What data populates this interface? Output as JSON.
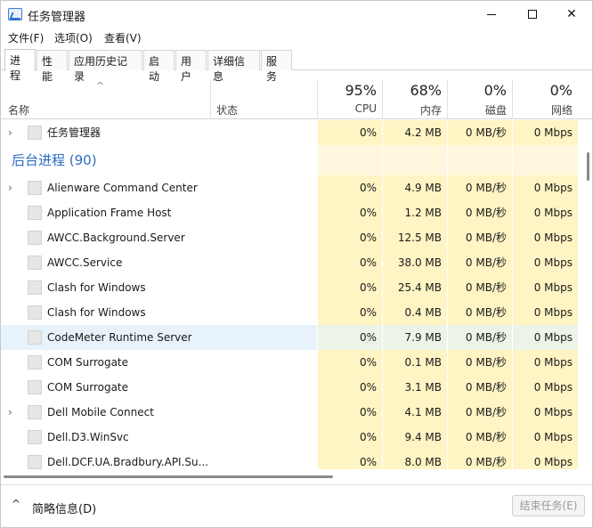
{
  "window": {
    "title": "任务管理器",
    "icon": "task-manager-icon",
    "controls": {
      "minimize": "minimize-icon",
      "maximize": "maximize-icon",
      "close": "✕"
    }
  },
  "menu": [
    {
      "label": "文件(F)"
    },
    {
      "label": "选项(O)"
    },
    {
      "label": "查看(V)"
    }
  ],
  "tabs": [
    {
      "label": "进程",
      "active": true
    },
    {
      "label": "性能"
    },
    {
      "label": "应用历史记录"
    },
    {
      "label": "启动"
    },
    {
      "label": "用户"
    },
    {
      "label": "详细信息"
    },
    {
      "label": "服务"
    }
  ],
  "header": {
    "sort_arrow": "^",
    "name": "名称",
    "status": "状态",
    "cpu_pct": "95%",
    "cpu": "CPU",
    "mem_pct": "68%",
    "mem": "内存",
    "disk_pct": "0%",
    "disk": "磁盘",
    "net_pct": "0%",
    "net": "网络"
  },
  "rows": [
    {
      "name": "任务管理器",
      "expand": "›",
      "cpu": "0%",
      "mem": "4.2 MB",
      "disk": "0 MB/秒",
      "net": "0 Mbps"
    },
    {
      "group": "后台进程 (90)"
    },
    {
      "name": "Alienware Command Center ...",
      "expand": "›",
      "cpu": "0%",
      "mem": "4.9 MB",
      "disk": "0 MB/秒",
      "net": "0 Mbps"
    },
    {
      "name": "Application Frame Host",
      "cpu": "0%",
      "mem": "1.2 MB",
      "disk": "0 MB/秒",
      "net": "0 Mbps"
    },
    {
      "name": "AWCC.Background.Server",
      "cpu": "0%",
      "mem": "12.5 MB",
      "disk": "0 MB/秒",
      "net": "0 Mbps"
    },
    {
      "name": "AWCC.Service",
      "cpu": "0%",
      "mem": "38.0 MB",
      "disk": "0 MB/秒",
      "net": "0 Mbps"
    },
    {
      "name": "Clash for Windows",
      "cpu": "0%",
      "mem": "25.4 MB",
      "disk": "0 MB/秒",
      "net": "0 Mbps"
    },
    {
      "name": "Clash for Windows",
      "cpu": "0%",
      "mem": "0.4 MB",
      "disk": "0 MB/秒",
      "net": "0 Mbps"
    },
    {
      "name": "CodeMeter Runtime Server (...",
      "cpu": "0%",
      "mem": "7.9 MB",
      "disk": "0 MB/秒",
      "net": "0 Mbps",
      "highlight": true
    },
    {
      "name": "COM Surrogate",
      "cpu": "0%",
      "mem": "0.1 MB",
      "disk": "0 MB/秒",
      "net": "0 Mbps"
    },
    {
      "name": "COM Surrogate",
      "cpu": "0%",
      "mem": "3.1 MB",
      "disk": "0 MB/秒",
      "net": "0 Mbps"
    },
    {
      "name": "Dell Mobile Connect",
      "expand": "›",
      "cpu": "0%",
      "mem": "4.1 MB",
      "disk": "0 MB/秒",
      "net": "0 Mbps"
    },
    {
      "name": "Dell.D3.WinSvc",
      "cpu": "0%",
      "mem": "9.4 MB",
      "disk": "0 MB/秒",
      "net": "0 Mbps"
    },
    {
      "name": "Dell.DCF.UA.Bradbury.API.Su...",
      "cpu": "0%",
      "mem": "8.0 MB",
      "disk": "0 MB/秒",
      "net": "0 Mbps"
    }
  ],
  "footer": {
    "chevron": "^",
    "details": "简略信息(D)",
    "end_task": "结束任务(E)"
  },
  "colors": {
    "heat": "#fff4c4",
    "group_title": "#2b6cc4",
    "row_highlight": "#e8f2fb"
  }
}
